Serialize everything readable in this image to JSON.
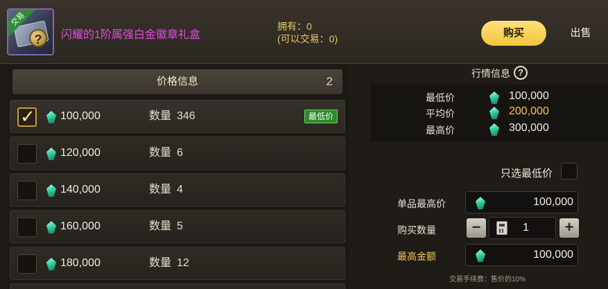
{
  "item": {
    "name": "闪耀的1阶属强白金徽章礼盒",
    "trade_tag": "交易",
    "owned_line1": "拥有：0",
    "owned_line2": "(可以交易：0)"
  },
  "tabs": {
    "buy": "购买",
    "sell": "出售"
  },
  "price_list": {
    "title": "价格信息",
    "count": "2",
    "qty_label": "数量",
    "lowest_badge": "最低价",
    "rows": [
      {
        "price": "100,000",
        "qty": "346",
        "checked": true
      },
      {
        "price": "120,000",
        "qty": "6",
        "checked": false
      },
      {
        "price": "140,000",
        "qty": "4",
        "checked": false
      },
      {
        "price": "160,000",
        "qty": "5",
        "checked": false
      },
      {
        "price": "180,000",
        "qty": "12",
        "checked": false
      }
    ]
  },
  "market": {
    "title": "行情信息",
    "help": "?",
    "lowest_label": "最低价",
    "lowest_value": "100,000",
    "avg_label": "平均价",
    "avg_value": "200,000",
    "highest_label": "最高价",
    "highest_value": "300,000"
  },
  "purchase": {
    "only_lowest_label": "只选最低价",
    "unit_max_label": "单品最高价",
    "unit_max_value": "100,000",
    "qty_label": "购买数量",
    "qty_value": "1",
    "minus": "−",
    "plus": "+",
    "total_label": "最高金额",
    "total_value": "100,000",
    "fee_note": "交易手续费：售价的10%"
  },
  "colors": {
    "item_name": "#e04ce0",
    "buy_tab": "#f2c53c",
    "gold_text": "#f2c55a",
    "lowest_badge": "#2f8a2c"
  }
}
